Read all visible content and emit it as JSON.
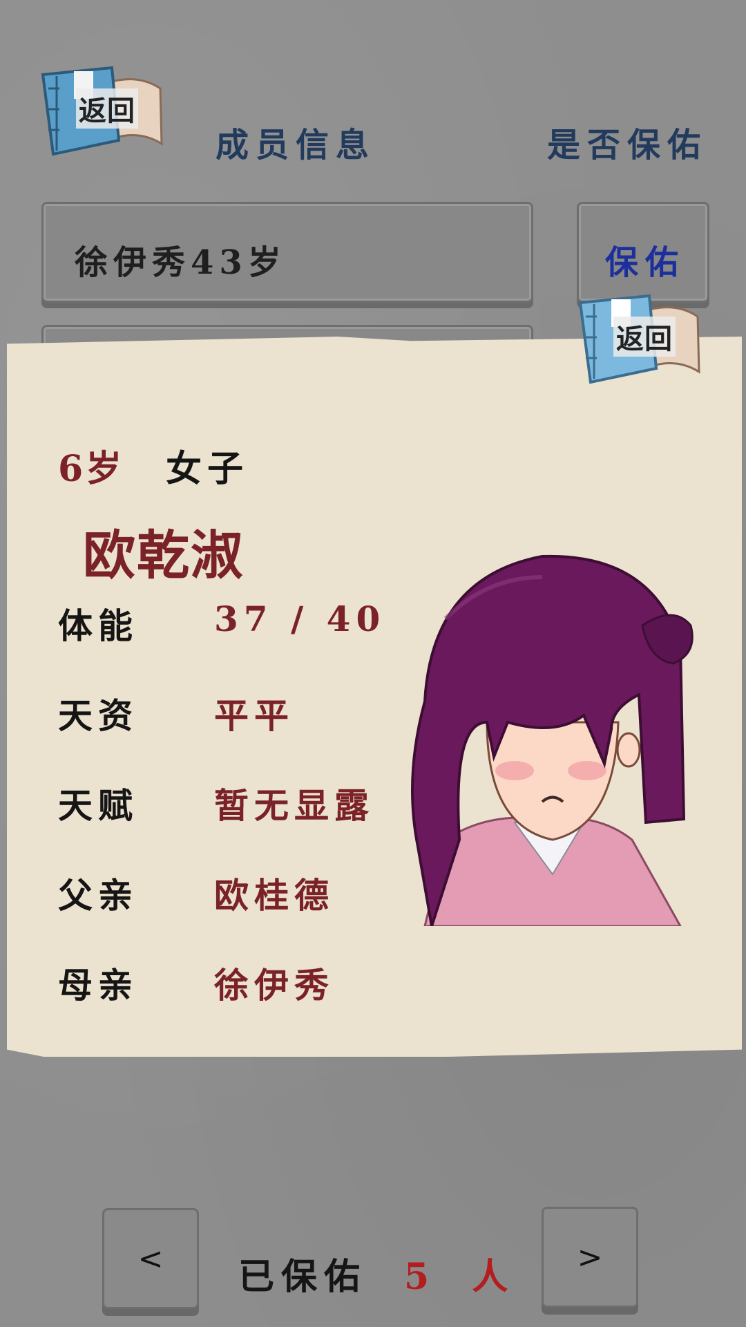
{
  "header": {
    "back_label": "返回",
    "title_member_info": "成员信息",
    "title_protect": "是否保佑"
  },
  "list": {
    "row_text": "徐伊秀43岁",
    "protect_button": "保佑"
  },
  "card": {
    "back_label": "返回",
    "age": "6岁",
    "gender": "女子",
    "name": "欧乾淑",
    "attributes": [
      {
        "label": "体能",
        "value": "37 / 40"
      },
      {
        "label": "天资",
        "value": "平平"
      },
      {
        "label": "天赋",
        "value": "暂无显露"
      },
      {
        "label": "父亲",
        "value": "欧桂德"
      },
      {
        "label": "母亲",
        "value": "徐伊秀"
      }
    ]
  },
  "footer": {
    "prev_label": "<",
    "next_label": ">",
    "protected_label": "已保佑",
    "protected_count": "5 人"
  },
  "colors": {
    "accent_red": "#7a2228",
    "protect_blue": "#1d2f9a",
    "header_navy": "#223a5c",
    "paper": "#ebe2cf",
    "hair_purple": "#6a1a5c"
  }
}
